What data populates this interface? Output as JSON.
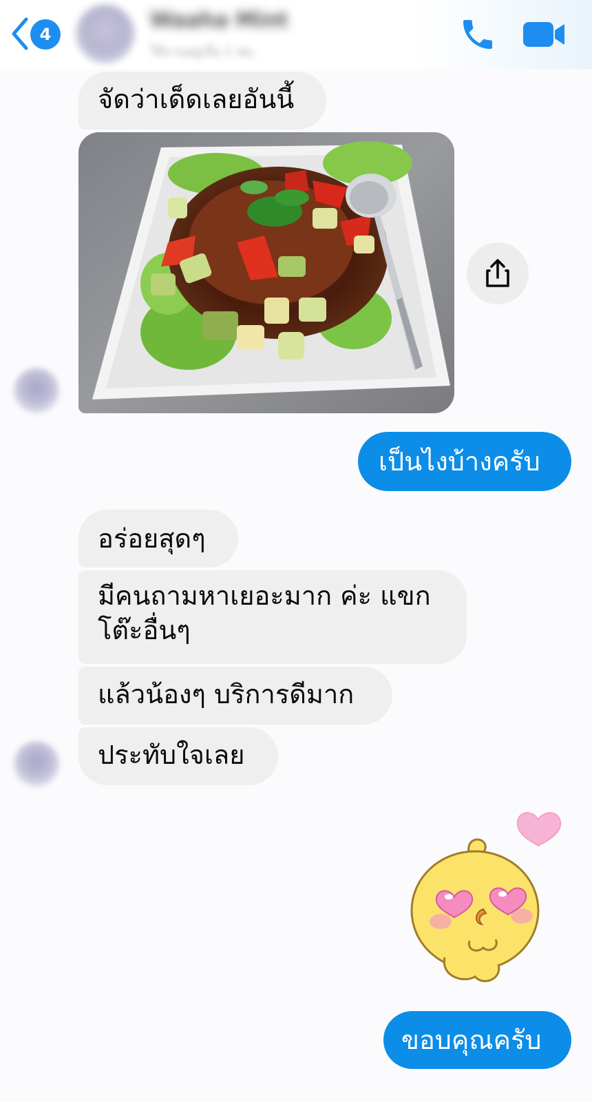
{
  "header": {
    "unread_count": "4",
    "contact_name": "Waaha Mint",
    "contact_status": "ใช้งานอยู่เมื่อ 1 ชม."
  },
  "icons": {
    "back": "chevron-left-icon",
    "call": "phone-icon",
    "video": "video-camera-icon",
    "share": "share-icon"
  },
  "colors": {
    "accent": "#1e8df0",
    "outgoing_bubble": "#0c8de8",
    "incoming_bubble": "#efefef"
  },
  "messages": [
    {
      "direction": "incoming",
      "text": "จัดว่าเด็ดเลยอันนี้"
    },
    {
      "direction": "incoming",
      "type": "photo"
    },
    {
      "direction": "outgoing",
      "text": "เป็นไงบ้างครับ"
    },
    {
      "direction": "incoming",
      "text": "อร่อยสุดๆ"
    },
    {
      "direction": "incoming",
      "text": "มีคนถามหาเยอะมาก ค่ะ แขกโต๊ะอื่นๆ"
    },
    {
      "direction": "incoming",
      "text": "แล้วน้องๆ บริการดีมาก"
    },
    {
      "direction": "incoming",
      "text": "ประทับใจเลย"
    },
    {
      "direction": "outgoing",
      "type": "sticker"
    },
    {
      "direction": "outgoing",
      "text": "ขอบคุณครับ"
    }
  ]
}
